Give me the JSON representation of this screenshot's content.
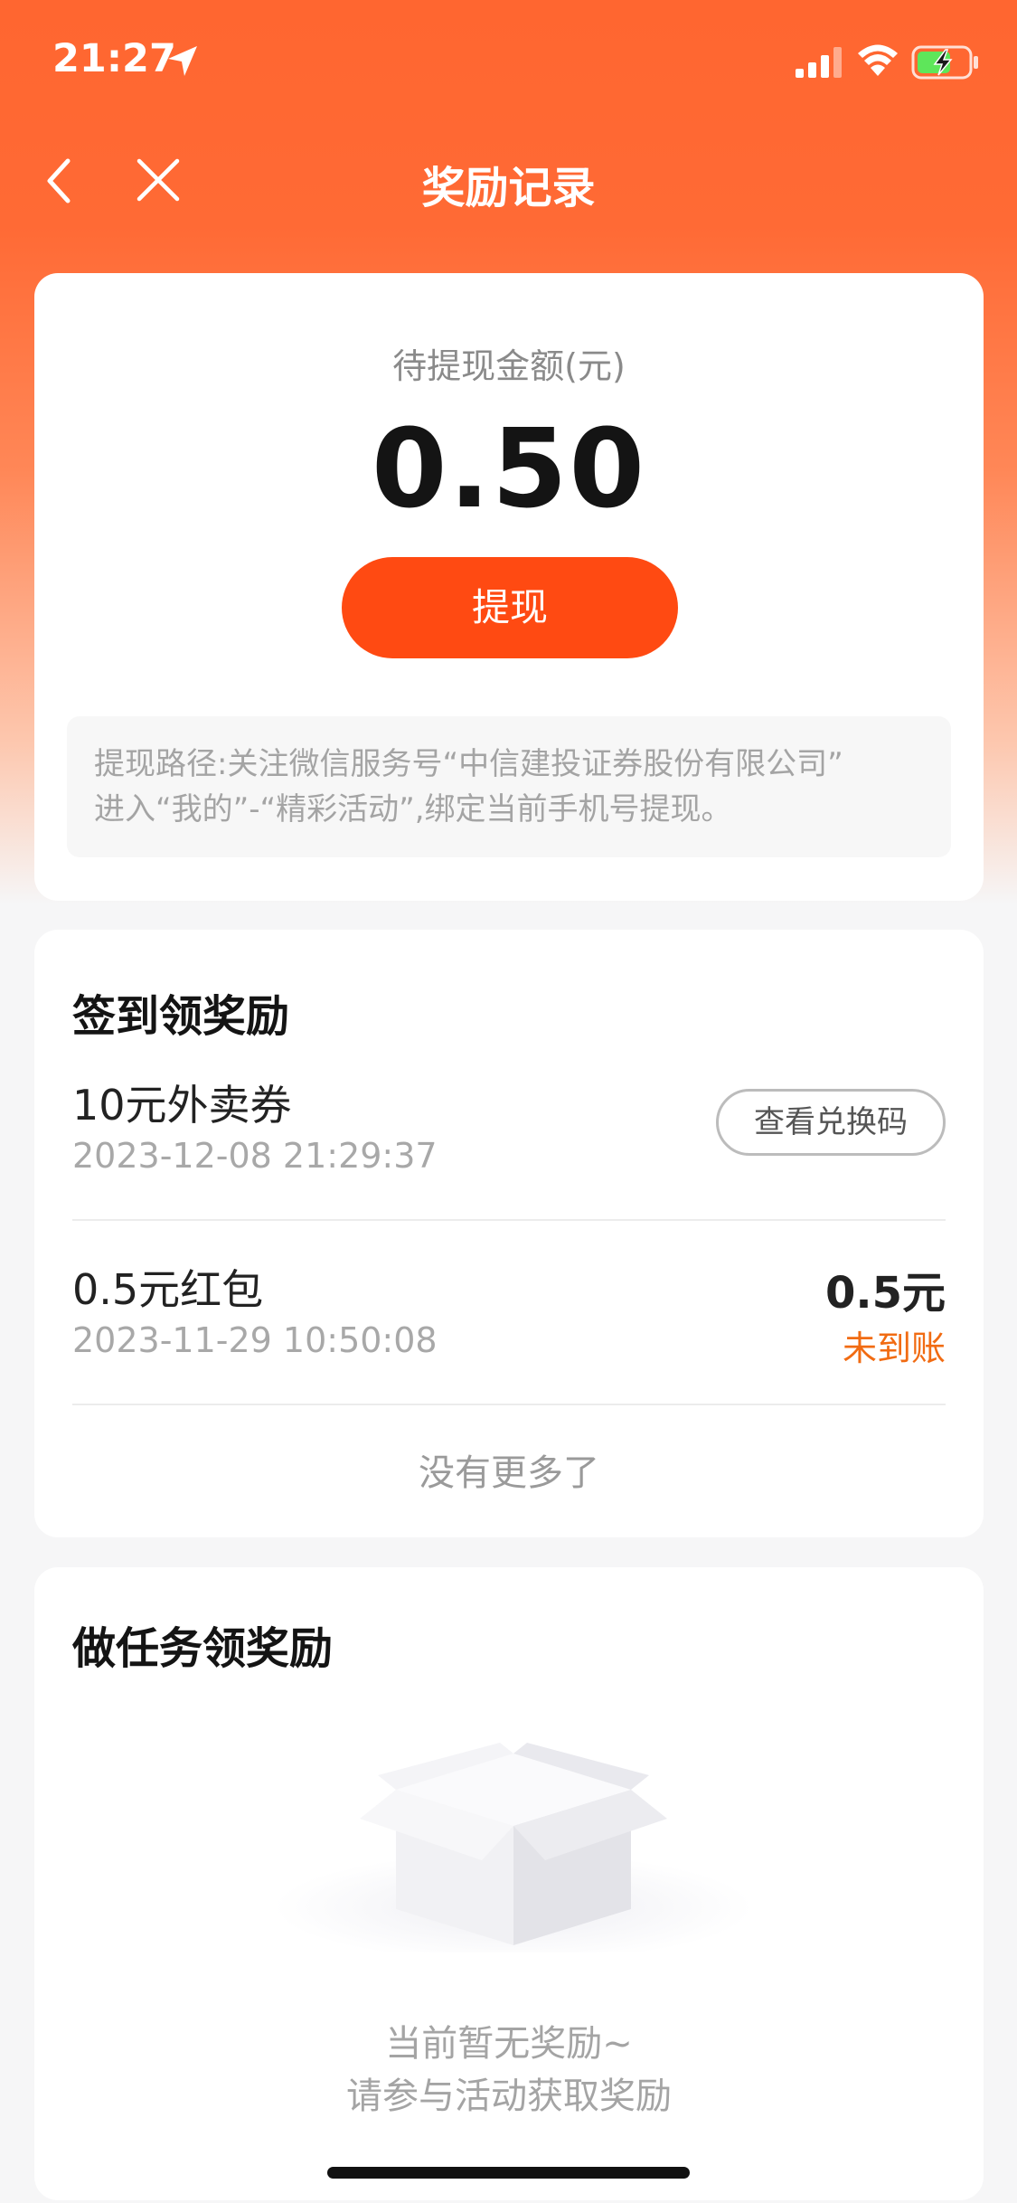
{
  "status_bar": {
    "time": "21:27"
  },
  "header": {
    "title": "奖励记录"
  },
  "withdraw": {
    "label": "待提现金额(元)",
    "amount": "0.50",
    "button_label": "提现",
    "tip_line1": "提现路径:关注微信服务号“中信建投证券股份有限公司”",
    "tip_line2": "进入“我的”-“精彩活动”,绑定当前手机号提现。"
  },
  "checkin": {
    "title": "签到领奖励",
    "items": [
      {
        "name": "10元外卖券",
        "time": "2023-12-08 21:29:37",
        "action_label": "查看兑换码"
      },
      {
        "name": "0.5元红包",
        "time": "2023-11-29 10:50:08",
        "amount": "0.5元",
        "status": "未到账"
      }
    ],
    "no_more": "没有更多了"
  },
  "task": {
    "title": "做任务领奖励",
    "empty_line1": "当前暂无奖励~",
    "empty_line2": "请参与活动获取奖励"
  },
  "colors": {
    "header_orange": "#ff6630",
    "button_orange": "#ff4a12",
    "status_orange": "#f16b12"
  },
  "icons": [
    "location-arrow-icon",
    "signal-icon",
    "wifi-icon",
    "battery-charging-icon",
    "back-chevron-icon",
    "close-icon",
    "empty-box-icon"
  ]
}
